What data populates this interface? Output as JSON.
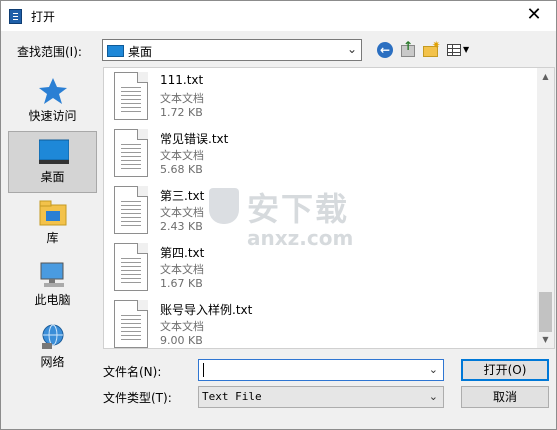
{
  "window": {
    "title": "打开",
    "close_glyph": "✕"
  },
  "lookin": {
    "label": "查找范围(I):",
    "value": "桌面"
  },
  "toolbar_icons": [
    "back-icon",
    "up-folder-icon",
    "new-folder-icon",
    "view-menu-icon"
  ],
  "places": [
    {
      "label": "快速访问",
      "icon": "star-icon"
    },
    {
      "label": "桌面",
      "icon": "desktop-icon",
      "selected": true
    },
    {
      "label": "库",
      "icon": "library-icon"
    },
    {
      "label": "此电脑",
      "icon": "computer-icon"
    },
    {
      "label": "网络",
      "icon": "network-icon"
    }
  ],
  "files": [
    {
      "name": "111.txt",
      "type": "文本文档",
      "size": "1.72 KB"
    },
    {
      "name": "常见错误.txt",
      "type": "文本文档",
      "size": "5.68 KB"
    },
    {
      "name": "第三.txt",
      "type": "文本文档",
      "size": "2.43 KB"
    },
    {
      "name": "第四.txt",
      "type": "文本文档",
      "size": "1.67 KB"
    },
    {
      "name": "账号导入样例.txt",
      "type": "文本文档",
      "size": "9.00 KB"
    }
  ],
  "watermark": {
    "text": "安下载",
    "sub": "anxz.com"
  },
  "bottom": {
    "filename_label": "文件名(N):",
    "filename_value": "",
    "filetype_label": "文件类型(T):",
    "filetype_value": "Text File",
    "open_label": "打开(O)",
    "cancel_label": "取消"
  },
  "colors": {
    "accent": "#0078d7",
    "desktop_blue": "#1e88d8",
    "selected_place": "#d4d4d4"
  }
}
